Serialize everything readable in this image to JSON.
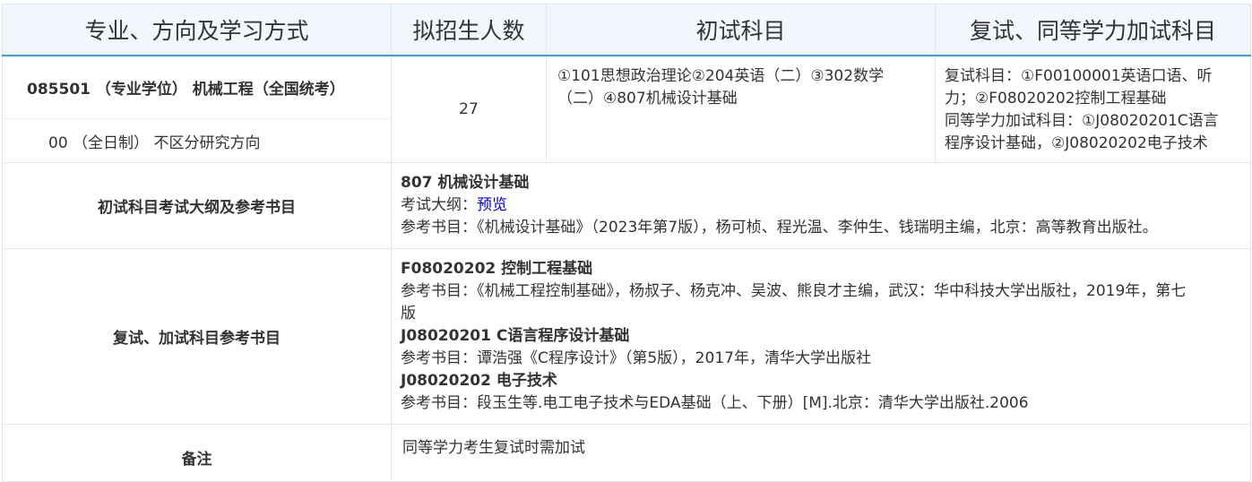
{
  "headers": {
    "major": "专业、方向及学习方式",
    "quota": "拟招生人数",
    "initial": "初试科目",
    "retest": "复试、同等学力加试科目"
  },
  "major": {
    "title": "085501 （专业学位） 机械工程（全国统考）",
    "direction": "00 （全日制） 不区分研究方向"
  },
  "quota": "27",
  "initial_subjects": {
    "line1": "①101思想政治理论②204英语（二）③302数学",
    "line2": "（二）④807机械设计基础"
  },
  "retest_subjects": {
    "line1": "复试科目：①F00100001英语口语、听",
    "line2": "力；②F08020202控制工程基础",
    "line3": "同等学力加试科目：①J08020201C语言",
    "line4": "程序设计基础，②J08020202电子技术"
  },
  "exam_outline": {
    "label": "初试科目考试大纲及参考书目",
    "subject": "807 机械设计基础",
    "outline_prefix": "考试大纲：",
    "preview_link": "预览",
    "reference": "参考书目：《机械设计基础》（2023年第7版），杨可桢、程光温、李仲生、钱瑞明主编，北京：高等教育出版社。"
  },
  "retest_refs": {
    "label": "复试、加试科目参考书目",
    "s1_title": "F08020202 控制工程基础",
    "s1_ref_line1": "参考书目：《机械工程控制基础》，杨叔子、杨克冲、吴波、熊良才主编，武汉：华中科技大学出版社，2019年，第七",
    "s1_ref_line2": "版",
    "s2_title": "J08020201 C语言程序设计基础",
    "s2_ref": "参考书目：谭浩强《C程序设计》（第5版），2017年，清华大学出版社",
    "s3_title": "J08020202 电子技术",
    "s3_ref": "参考书目：段玉生等.电工电子技术与EDA基础（上、下册）[M].北京：清华大学出版社.2006"
  },
  "remarks": {
    "label": "备注",
    "text": "同等学力考生复试时需加试"
  },
  "colors": {
    "header_bg": "#f2f7fd",
    "header_border": "#2aa7e0",
    "link": "#0000ee"
  }
}
